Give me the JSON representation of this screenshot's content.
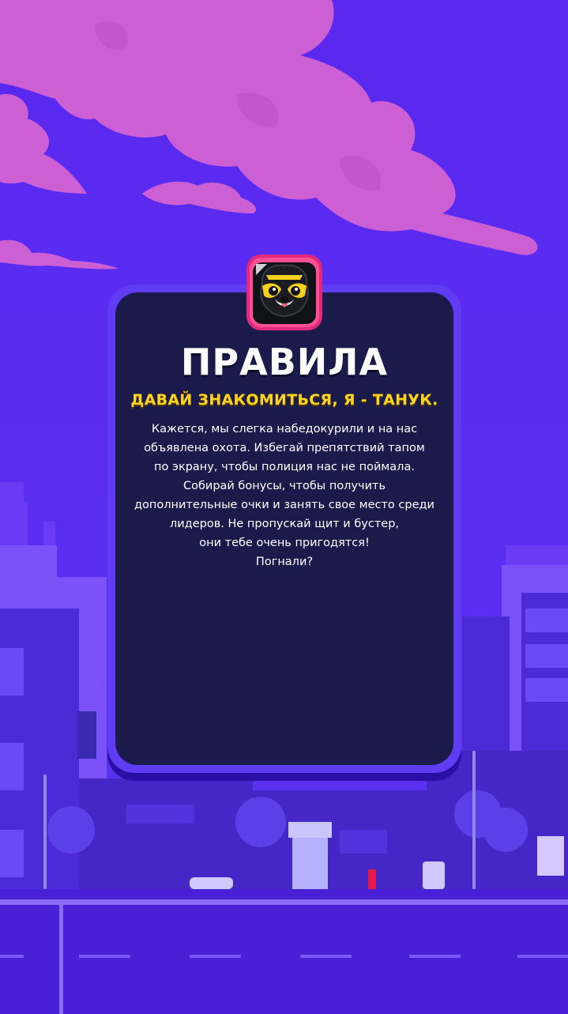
{
  "rules": {
    "title": "ПРАВИЛА",
    "subtitle": "ДАВАЙ ЗНАКОМИТЬСЯ, Я - ТАНУК.",
    "lines": [
      "Кажется, мы слегка набедокурили и на нас",
      "объявлена охота. Избегай препятствий тапом",
      "по экрану, чтобы полиция нас не поймала.",
      "Собирай бонусы, чтобы получить",
      "дополнительные очки и занять свое место среди",
      "лидеров. Не пропускай щит и бустер,",
      "они тебе очень пригодятся!",
      "Погнали?"
    ]
  },
  "icons": {
    "app": "raccoon-app-icon"
  },
  "colors": {
    "sky": "#5a2ff0",
    "clouds": "#d064d6",
    "panel": "#1a1a4b",
    "panel_border": "#5f3cf2",
    "title": "#ffffff",
    "subtitle": "#ffd51a"
  }
}
